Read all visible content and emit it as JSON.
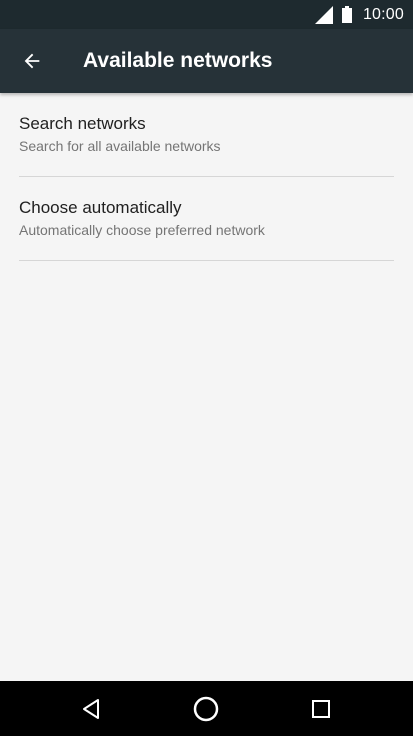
{
  "status_bar": {
    "time": "10:00",
    "icons": [
      "signal-icon",
      "battery-icon"
    ]
  },
  "app_bar": {
    "title": "Available networks",
    "back_icon": "arrow-back-icon"
  },
  "list": [
    {
      "title": "Search networks",
      "subtitle": "Search for all available networks"
    },
    {
      "title": "Choose automatically",
      "subtitle": "Automatically choose preferred network"
    }
  ],
  "nav_bar": {
    "icons": [
      "back-triangle-icon",
      "home-circle-icon",
      "recents-square-icon"
    ]
  },
  "colors": {
    "status_bar": "#1e2a2f",
    "app_bar": "#263238",
    "background": "#f5f5f5",
    "primary_text": "#212121",
    "secondary_text": "#757575",
    "nav_bar": "#000000"
  }
}
